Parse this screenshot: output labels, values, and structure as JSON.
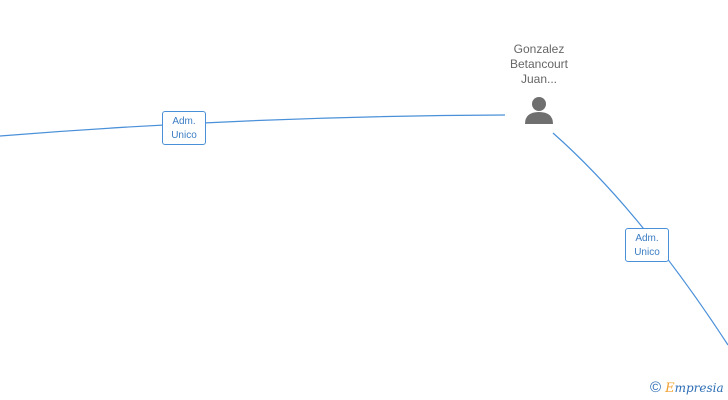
{
  "graph": {
    "node_person": {
      "name_lines": [
        "Gonzalez",
        "Betancourt",
        "Juan..."
      ],
      "icon": "person-icon"
    },
    "edges": [
      {
        "label_lines": [
          "Adm.",
          "Unico"
        ]
      },
      {
        "label_lines": [
          "Adm.",
          "Unico"
        ]
      }
    ],
    "colors": {
      "edge": "#4a90d9",
      "label_text": "#3b7dc4",
      "node_text": "#666666",
      "person_icon": "#6f6f6f"
    }
  },
  "footer": {
    "copyright_symbol": "©",
    "brand_initial": "E",
    "brand_rest": "mpresia"
  }
}
